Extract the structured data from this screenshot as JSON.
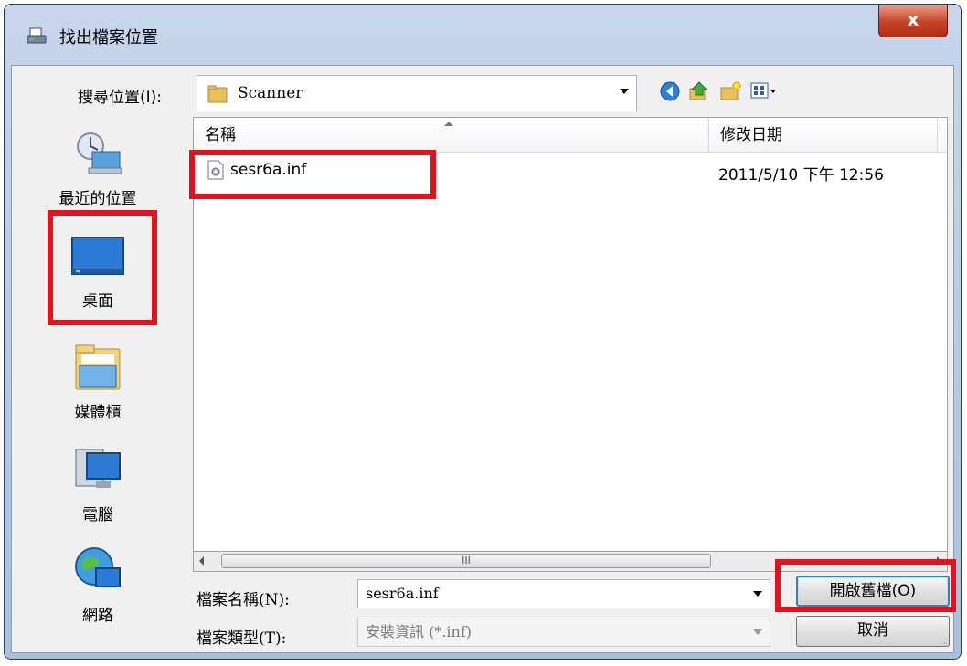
{
  "window": {
    "title": "找出檔案位置",
    "close_label": "x"
  },
  "look_in": {
    "label": "搜尋位置(I):",
    "value": "Scanner"
  },
  "places": [
    {
      "label": "最近的位置",
      "icon": "recent-places-icon"
    },
    {
      "label": "桌面",
      "icon": "desktop-icon"
    },
    {
      "label": "媒體櫃",
      "icon": "libraries-icon"
    },
    {
      "label": "電腦",
      "icon": "computer-icon"
    },
    {
      "label": "網路",
      "icon": "network-icon"
    }
  ],
  "file_list": {
    "columns": [
      "名稱",
      "修改日期",
      " "
    ],
    "rows": [
      {
        "name": "sesr6a.inf",
        "modified": "2011/5/10 下午 12:56"
      }
    ]
  },
  "scrollbar": {
    "grip": "III"
  },
  "filename": {
    "label": "檔案名稱(N):",
    "value": "sesr6a.inf"
  },
  "filetype": {
    "label": "檔案類型(T):",
    "value": "安裝資訊 (*.inf)"
  },
  "buttons": {
    "open": "開啟舊檔(O)",
    "cancel": "取消"
  },
  "colors": {
    "highlight": "#e0141e",
    "title_bar": "#b9cde5",
    "close_button": "#c7432a"
  }
}
